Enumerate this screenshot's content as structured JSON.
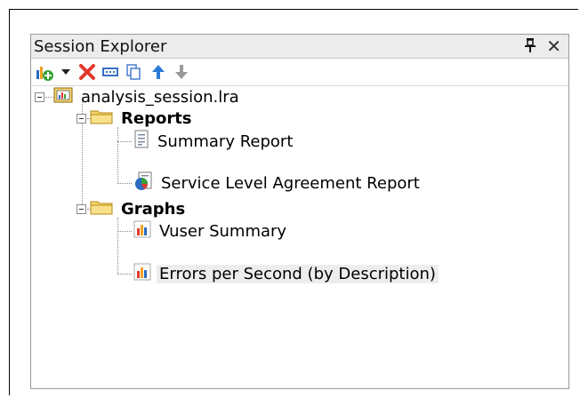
{
  "panel": {
    "title": "Session Explorer"
  },
  "titlebar_icons": {
    "pin": "pin-icon",
    "close": "close-icon"
  },
  "toolbar": {
    "buttons": [
      "add-item-icon",
      "dropdown-arrow-icon",
      "delete-icon",
      "rename-icon",
      "copy-icon",
      "move-up-icon",
      "move-down-icon"
    ]
  },
  "tree": {
    "root": "analysis_session.lra",
    "reports_folder": "Reports",
    "reports": [
      "Summary Report",
      "Service Level Agreement Report"
    ],
    "graphs_folder": "Graphs",
    "graphs": [
      "Vuser Summary",
      "Errors per Second (by Description)"
    ],
    "selected": "Errors per Second (by Description)"
  },
  "colors": {
    "folder": "#f6d46a",
    "delete": "#e2382c",
    "up_arrow": "#2b7bd6",
    "chart_bar_orange": "#f0a020",
    "chart_bar_blue": "#2a6bc4"
  }
}
